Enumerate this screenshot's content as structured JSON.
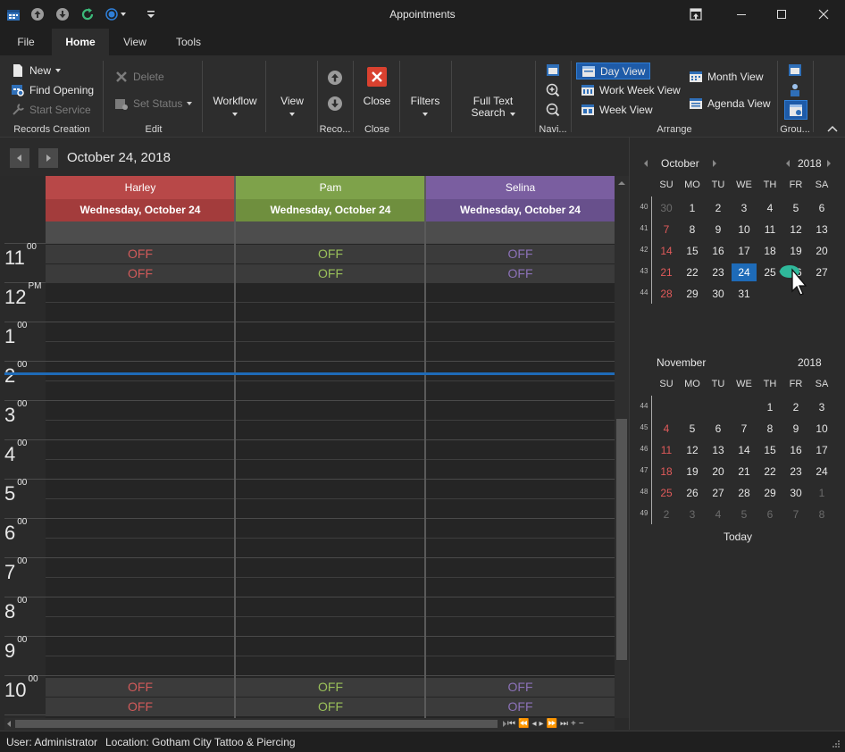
{
  "window": {
    "title": "Appointments"
  },
  "tabs": [
    {
      "label": "File"
    },
    {
      "label": "Home"
    },
    {
      "label": "View"
    },
    {
      "label": "Tools"
    }
  ],
  "ribbon": {
    "records_creation": {
      "new": "New",
      "find_opening": "Find Opening",
      "start_service": "Start Service",
      "label": "Records Creation"
    },
    "edit": {
      "delete": "Delete",
      "set_status": "Set Status",
      "label": "Edit"
    },
    "workflow": "Workflow",
    "view": "View",
    "records": {
      "label": "Reco..."
    },
    "close": {
      "button": "Close",
      "label": "Close"
    },
    "filters": "Filters",
    "full_text_search": {
      "line1": "Full Text",
      "line2": "Search"
    },
    "navigate": {
      "label": "Navi..."
    },
    "arrange": {
      "day_view": "Day View",
      "work_week_view": "Work Week View",
      "week_view": "Week View",
      "month_view": "Month View",
      "agenda_view": "Agenda View",
      "label": "Arrange"
    },
    "group": {
      "label": "Grou..."
    }
  },
  "scheduler": {
    "date_title": "October 24, 2018",
    "resources": [
      {
        "name": "Harley",
        "date": "Wednesday, October 24",
        "color": "#b84848",
        "date_color": "#a33c3c",
        "off_color": "#d05a5a"
      },
      {
        "name": "Pam",
        "date": "Wednesday, October 24",
        "color": "#7ea24a",
        "date_color": "#6f8f3e",
        "off_color": "#9ac05a"
      },
      {
        "name": "Selina",
        "date": "Wednesday, October 24",
        "color": "#7a5ea0",
        "date_color": "#68508c",
        "off_color": "#8c72b8"
      }
    ],
    "off_label": "OFF",
    "times": [
      {
        "h": "11",
        "m": "00"
      },
      {
        "h": "12",
        "m": "PM"
      },
      {
        "h": "1",
        "m": "00"
      },
      {
        "h": "2",
        "m": "00"
      },
      {
        "h": "3",
        "m": "00"
      },
      {
        "h": "4",
        "m": "00"
      },
      {
        "h": "5",
        "m": "00"
      },
      {
        "h": "6",
        "m": "00"
      },
      {
        "h": "7",
        "m": "00"
      },
      {
        "h": "8",
        "m": "00"
      },
      {
        "h": "9",
        "m": "00"
      },
      {
        "h": "10",
        "m": "00"
      }
    ]
  },
  "calendar": {
    "dow": [
      "SU",
      "MO",
      "TU",
      "WE",
      "TH",
      "FR",
      "SA"
    ],
    "october": {
      "month": "October",
      "year": "2018",
      "weeks": [
        "40",
        "41",
        "42",
        "43",
        "44"
      ],
      "days": [
        [
          "30",
          "1",
          "2",
          "3",
          "4",
          "5",
          "6"
        ],
        [
          "7",
          "8",
          "9",
          "10",
          "11",
          "12",
          "13"
        ],
        [
          "14",
          "15",
          "16",
          "17",
          "18",
          "19",
          "20"
        ],
        [
          "21",
          "22",
          "23",
          "24",
          "25",
          "26",
          "27"
        ],
        [
          "28",
          "29",
          "30",
          "31",
          "",
          "",
          ""
        ]
      ]
    },
    "november": {
      "month": "November",
      "year": "2018",
      "weeks": [
        "44",
        "45",
        "46",
        "47",
        "48",
        "49"
      ],
      "days": [
        [
          "",
          "",
          "",
          "",
          "1",
          "2",
          "3"
        ],
        [
          "4",
          "5",
          "6",
          "7",
          "8",
          "9",
          "10"
        ],
        [
          "11",
          "12",
          "13",
          "14",
          "15",
          "16",
          "17"
        ],
        [
          "18",
          "19",
          "20",
          "21",
          "22",
          "23",
          "24"
        ],
        [
          "25",
          "26",
          "27",
          "28",
          "29",
          "30",
          "1"
        ],
        [
          "2",
          "3",
          "4",
          "5",
          "6",
          "7",
          "8"
        ]
      ]
    },
    "today_label": "Today"
  },
  "status": {
    "user": "User: Administrator",
    "location": "Location: Gotham City Tattoo & Piercing"
  }
}
